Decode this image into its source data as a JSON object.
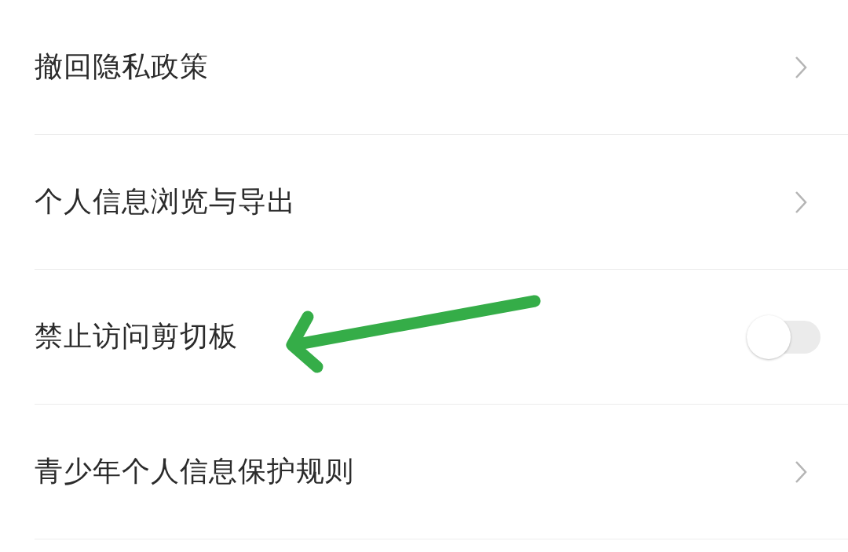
{
  "settings": [
    {
      "kind": "link",
      "label": "撤回隐私政策"
    },
    {
      "kind": "link",
      "label": "个人信息浏览与导出"
    },
    {
      "kind": "toggle",
      "label": "禁止访问剪切板",
      "on": false
    },
    {
      "kind": "link",
      "label": "青少年个人信息保护规则"
    }
  ],
  "annotation": {
    "kind": "arrow"
  }
}
